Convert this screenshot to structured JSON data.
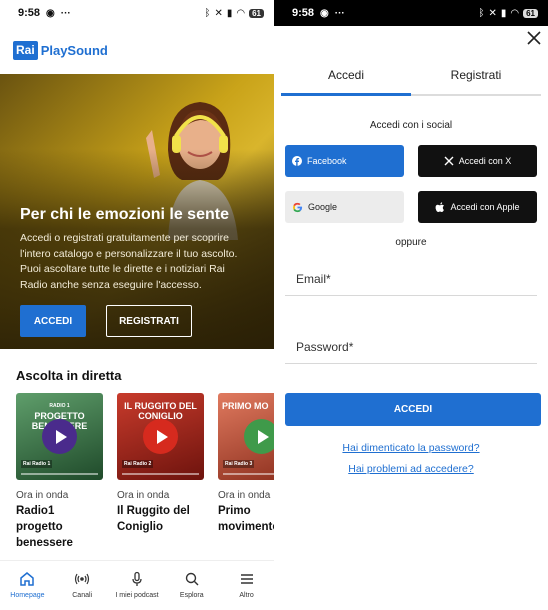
{
  "left": {
    "status": {
      "time": "9:58",
      "battery": "61"
    },
    "logo": {
      "box": "Rai",
      "text": "PlaySound"
    },
    "hero": {
      "title": "Per chi le emozioni le sente",
      "lines": [
        "Accedi o registrati gratuitamente per scoprire",
        "l'intero catalogo e personalizzare il tuo ascolto.",
        "Puoi ascoltare tutte le dirette e i notiziari Rai",
        "Radio anche senza eseguire l'accesso."
      ],
      "login_button": "ACCEDI",
      "register_button": "REGISTRATI"
    },
    "live": {
      "title": "Ascolta in diretta",
      "cards": [
        {
          "caption_small": "RADIO 1",
          "caption": "PROGETTO BENESSERE",
          "badge": "Rai Radio 1",
          "onair": "Ora in onda",
          "name_lines": [
            "Radio1",
            "progetto",
            "benessere"
          ]
        },
        {
          "caption_small": "",
          "caption": "IL RUGGITO DEL CONIGLIO",
          "badge": "Rai Radio 2",
          "onair": "Ora in onda",
          "name_lines": [
            "Il Ruggito del",
            "Coniglio"
          ]
        },
        {
          "caption_small": "",
          "caption": "PRIMO MO",
          "badge": "Rai Radio 3",
          "onair": "Ora in onda",
          "name_lines": [
            "Primo",
            "movimento"
          ]
        }
      ]
    },
    "nav": [
      {
        "label": "Homepage",
        "icon": "home-icon",
        "active": true
      },
      {
        "label": "Canali",
        "icon": "broadcast-icon",
        "active": false
      },
      {
        "label": "I miei podcast",
        "icon": "microphone-icon",
        "active": false
      },
      {
        "label": "Esplora",
        "icon": "search-icon",
        "active": false
      },
      {
        "label": "Altro",
        "icon": "menu-icon",
        "active": false
      }
    ],
    "colors": {
      "brand": "#1f6fd1",
      "card1": "#2d6b3f",
      "card2": "#b3261e",
      "card3": "#c9503a",
      "play1": "#4a2b8c",
      "play2": "#d62a1e",
      "play3": "#3f9a4a"
    }
  },
  "right": {
    "status": {
      "time": "9:58",
      "battery": "61"
    },
    "tabs": [
      "Accedi",
      "Registrati"
    ],
    "social_heading": "Accedi con i social",
    "social": {
      "facebook": "Facebook",
      "x": "Accedi con X",
      "google": "Google",
      "apple": "Accedi con Apple"
    },
    "or_text": "oppure",
    "email_label": "Email*",
    "password_label": "Password*",
    "login_button": "ACCEDI",
    "forgot_link": "Hai dimenticato la password?",
    "problems_link": "Hai problemi ad accedere?"
  }
}
